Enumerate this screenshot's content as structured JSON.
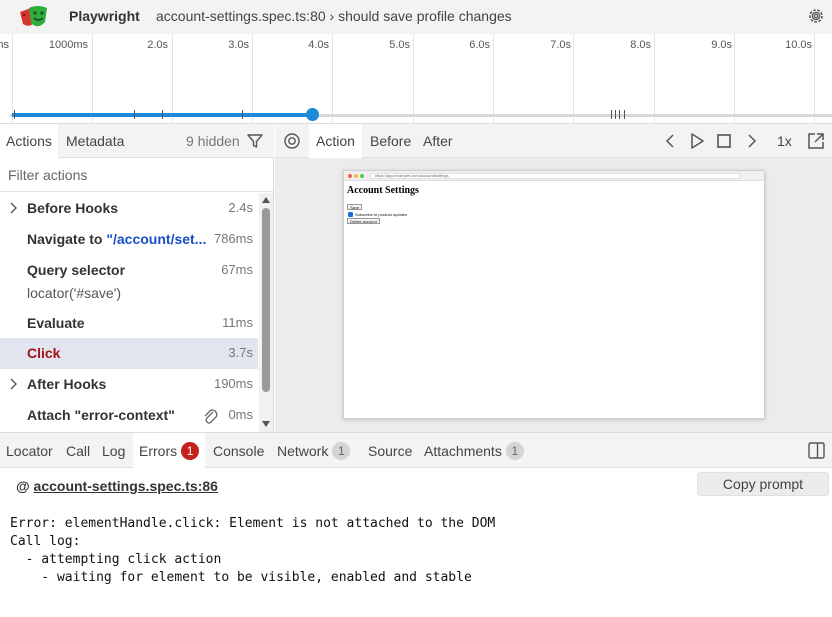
{
  "header": {
    "app_title": "Playwright",
    "test_title": "account-settings.spec.ts:80 › should save profile changes",
    "logo_icon": "playwright-masks-logo",
    "settings_icon": "gear-icon"
  },
  "timeline": {
    "ticks": [
      "ms",
      "1000ms",
      "2.0s",
      "3.0s",
      "4.0s",
      "5.0s",
      "6.0s",
      "7.0s",
      "8.0s",
      "9.0s",
      "10.0s"
    ],
    "selection_progress_pct": 38,
    "accent_color": "#1d8ad9"
  },
  "actions_panel": {
    "tab_actions": "Actions",
    "tab_metadata": "Metadata",
    "hidden_count": "9 hidden",
    "filter_placeholder": "Filter actions",
    "items": [
      {
        "title": "Before Hooks",
        "time": "2.4s",
        "expandable": true
      },
      {
        "title": "Navigate to ",
        "locator": "\"/account/set...",
        "time": "786ms"
      },
      {
        "title": "Query selector",
        "subtitle": "locator('#save')",
        "time": "67ms"
      },
      {
        "title": "Evaluate",
        "time": "11ms"
      },
      {
        "title": "Click",
        "time": "3.7s",
        "selected": true,
        "error_color": "#a11616"
      },
      {
        "title": "After Hooks",
        "time": "190ms",
        "expandable": true
      },
      {
        "title": "Attach \"error-context\"",
        "time": "0ms",
        "has_attachment": true
      }
    ]
  },
  "snapshot_panel": {
    "tab_action": "Action",
    "tab_before": "Before",
    "tab_after": "After",
    "speed": "1x",
    "snapshot": {
      "url": "https://app.example.com/account/settings",
      "heading": "Account Settings",
      "save_button": "Save",
      "checkbox_label": "Subscribe to product updates",
      "delete_button": "Delete account"
    }
  },
  "bottom_tabs": {
    "locator": "Locator",
    "call": "Call",
    "log": "Log",
    "errors": "Errors",
    "errors_count": "1",
    "console": "Console",
    "network": "Network",
    "network_count": "1",
    "source": "Source",
    "attachments": "Attachments",
    "attachments_count": "1"
  },
  "error_panel": {
    "at_symbol": "@",
    "source_link": "account-settings.spec.ts:86",
    "copy_prompt": "Copy prompt",
    "message": "Error: elementHandle.click: Element is not attached to the DOM\nCall log:\n  - attempting click action\n    - waiting for element to be visible, enabled and stable"
  }
}
